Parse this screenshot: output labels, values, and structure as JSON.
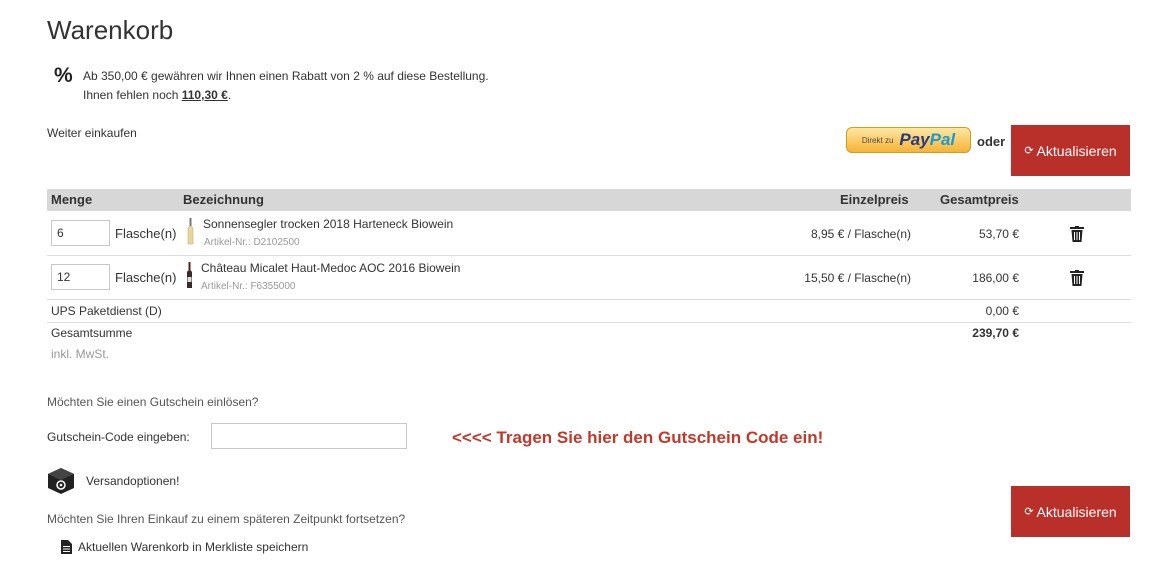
{
  "page_title": "Warenkorb",
  "rebate": {
    "icon": "percent-icon",
    "line1": "Ab 350,00 € gewähren wir Ihnen einen Rabatt von 2 % auf diese Bestellung.",
    "line2_prefix": "Ihnen fehlen noch ",
    "line2_amount": "110,30 €",
    "line2_suffix": "."
  },
  "continue_shopping": "Weiter einkaufen",
  "paypal": {
    "prefix": "Direkt zu",
    "brand1": "Pay",
    "brand2": "Pal"
  },
  "oder": "oder",
  "update_button": "Aktualisieren",
  "table": {
    "headers": {
      "menge": "Menge",
      "bezeichnung": "Bezeichnung",
      "einzelpreis": "Einzelpreis",
      "gesamtpreis": "Gesamtpreis"
    },
    "items": [
      {
        "qty": "6",
        "unit": "Flasche(n)",
        "name": "Sonnensegler trocken 2018 Harteneck Biowein",
        "article_no": "Artikel-Nr.: D2102500",
        "unit_price": "8,95 € / Flasche(n)",
        "total": "53,70 €",
        "bottle_color": "#e8d79a"
      },
      {
        "qty": "12",
        "unit": "Flasche(n)",
        "name": "Château Micalet Haut-Medoc AOC 2016 Biowein",
        "article_no": "Artikel-Nr.: F6355000",
        "unit_price": "15,50 € / Flasche(n)",
        "total": "186,00 €",
        "bottle_color": "#3a2a2a"
      }
    ],
    "shipping": {
      "label": "UPS Paketdienst (D)",
      "total": "0,00 €"
    },
    "sum": {
      "label": "Gesamtsumme",
      "total": "239,70 €",
      "note": "inkl. MwSt."
    }
  },
  "voucher": {
    "question": "Möchten Sie einen Gutschein einlösen?",
    "label": "Gutschein-Code eingeben:",
    "value": "",
    "hint": "<<<<  Tragen Sie hier den Gutschein Code ein!"
  },
  "shipping_options": "Versandoptionen!",
  "later": {
    "question": "Möchten Sie Ihren Einkauf zu einem späteren Zeitpunkt fortsetzen?",
    "save_link": "Aktuellen Warenkorb in Merkliste speichern"
  },
  "colors": {
    "accent": "#b9302a",
    "hint": "#c0392b",
    "header_bg": "#d7d7d7"
  }
}
